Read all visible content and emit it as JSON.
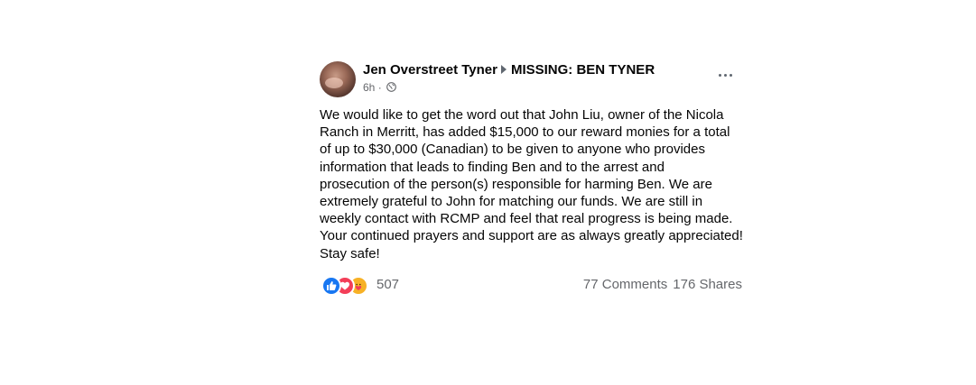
{
  "post": {
    "author": "Jen Overstreet Tyner",
    "group": "MISSING: BEN TYNER",
    "time": "6h",
    "separator": "·",
    "privacy_icon": "globe-icon",
    "body": "We would like to get the word out that John Liu, owner of the Nicola\nRanch in Merritt, has added $15,000 to our reward monies for a total\nof up to $30,000 (Canadian) to be given to anyone who provides\ninformation that leads to finding Ben and to the arrest and\nprosecution of the person(s) responsible for harming Ben. We are\nextremely grateful to John for matching our funds.  We are still in\nweekly contact with RCMP and feel that real progress is being made.\nYour continued prayers and support are as always greatly appreciated!\nStay safe!",
    "reactions": {
      "icons": [
        "like-icon",
        "love-icon",
        "care-icon"
      ],
      "count": "507"
    },
    "comments": "77 Comments",
    "shares": "176 Shares"
  },
  "colors": {
    "like": "#1877f2",
    "love": "#f33e58",
    "care": "#f7b125",
    "secondary_text": "#65676b"
  }
}
